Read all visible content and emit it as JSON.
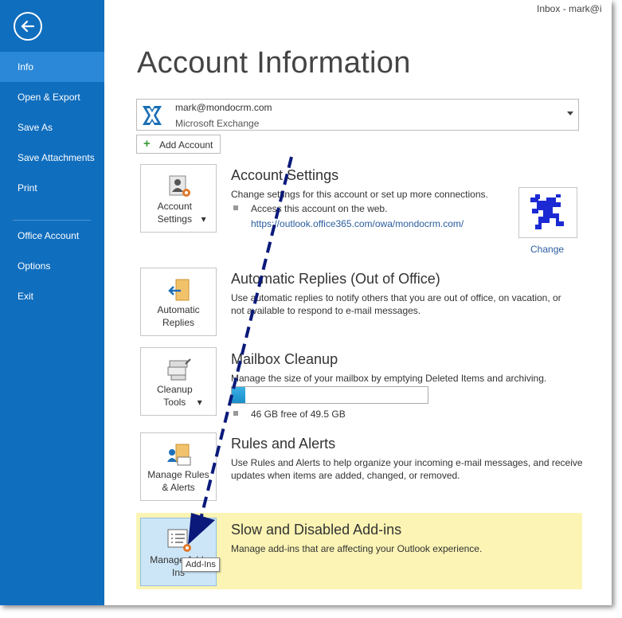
{
  "window": {
    "title": "Inbox - mark@i"
  },
  "sidebar": {
    "back_icon": "back-arrow-icon",
    "items": [
      {
        "label": "Info",
        "active": true
      },
      {
        "label": "Open & Export"
      },
      {
        "label": "Save As"
      },
      {
        "label": "Save Attachments"
      },
      {
        "label": "Print"
      },
      {
        "label": "Office Account"
      },
      {
        "label": "Options"
      },
      {
        "label": "Exit"
      }
    ]
  },
  "main": {
    "title": "Account Information",
    "account": {
      "email": "mark@mondocrm.com",
      "type": "Microsoft Exchange"
    },
    "add_account": "Add Account",
    "sections": {
      "account_settings": {
        "tile_label": "Account Settings",
        "title": "Account Settings",
        "description": "Change settings for this account or set up more connections.",
        "bullet_text": "Access this account on the web.",
        "link": "https://outlook.office365.com/owa/mondocrm.com/",
        "change_link": "Change"
      },
      "automatic_replies": {
        "tile_label": "Automatic Replies",
        "title": "Automatic Replies (Out of Office)",
        "description_line1": "Use automatic replies to notify others that you are out of office, on vacation, or",
        "description_line2": "not available to respond to e-mail messages."
      },
      "mailbox_cleanup": {
        "tile_label": "Cleanup Tools",
        "title": "Mailbox Cleanup",
        "description": "Manage the size of your mailbox by emptying Deleted Items and archiving.",
        "storage_text": "46 GB free of 49.5 GB",
        "used_fraction": 0.07
      },
      "rules_alerts": {
        "tile_label": "Manage Rules & Alerts",
        "title": "Rules and Alerts",
        "description_line1": "Use Rules and Alerts to help organize your incoming e-mail messages, and receive",
        "description_line2": "updates when items are added, changed, or removed."
      },
      "addins": {
        "tile_label": "Manage Add-Ins",
        "title": "Slow and Disabled Add-ins",
        "description": "Manage add-ins that are affecting your Outlook experience.",
        "tooltip": "Add-Ins"
      }
    }
  },
  "colors": {
    "sidebar": "#106ebe",
    "sidebar_active": "#2b88d8",
    "highlight_band": "#fbf4b4",
    "arrow": "#0b1a7a"
  }
}
